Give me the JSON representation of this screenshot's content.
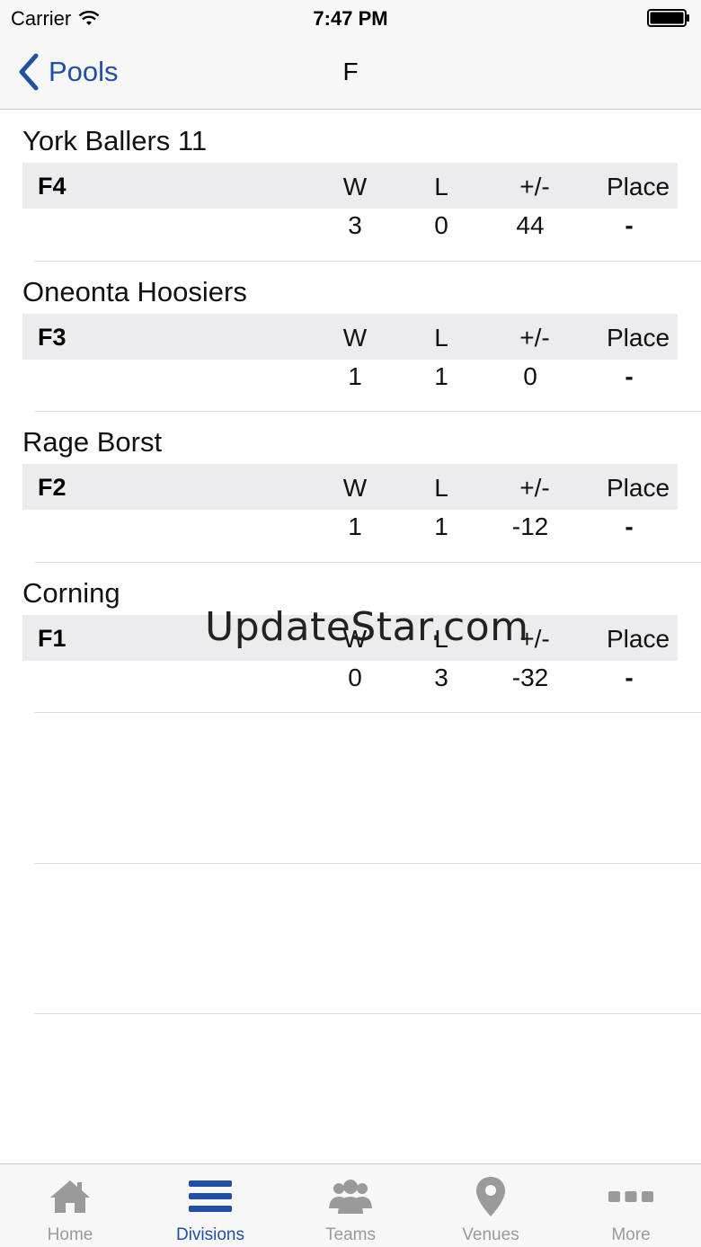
{
  "status_bar": {
    "carrier": "Carrier",
    "time": "7:47 PM"
  },
  "nav": {
    "back_label": "Pools",
    "title": "F"
  },
  "columns": {
    "w": "W",
    "l": "L",
    "plus_minus": "+/-",
    "place": "Place"
  },
  "teams": [
    {
      "name": "York Ballers 11",
      "pool": "F4",
      "w": "3",
      "l": "0",
      "plus_minus": "44",
      "place": "-"
    },
    {
      "name": "Oneonta Hoosiers",
      "pool": "F3",
      "w": "1",
      "l": "1",
      "plus_minus": "0",
      "place": "-"
    },
    {
      "name": "Rage Borst",
      "pool": "F2",
      "w": "1",
      "l": "1",
      "plus_minus": "-12",
      "place": "-"
    },
    {
      "name": "Corning",
      "pool": "F1",
      "w": "0",
      "l": "3",
      "plus_minus": "-32",
      "place": "-"
    }
  ],
  "watermark": "UpdateStar.com",
  "tabs": [
    {
      "label": "Home",
      "icon": "home-icon",
      "active": false
    },
    {
      "label": "Divisions",
      "icon": "list-icon",
      "active": true
    },
    {
      "label": "Teams",
      "icon": "people-icon",
      "active": false
    },
    {
      "label": "Venues",
      "icon": "map-pin-icon",
      "active": false
    },
    {
      "label": "More",
      "icon": "more-icon",
      "active": false
    }
  ],
  "colors": {
    "accent": "#1f4fa8",
    "inactive": "#9a9a9a",
    "header_row": "#ececef"
  }
}
